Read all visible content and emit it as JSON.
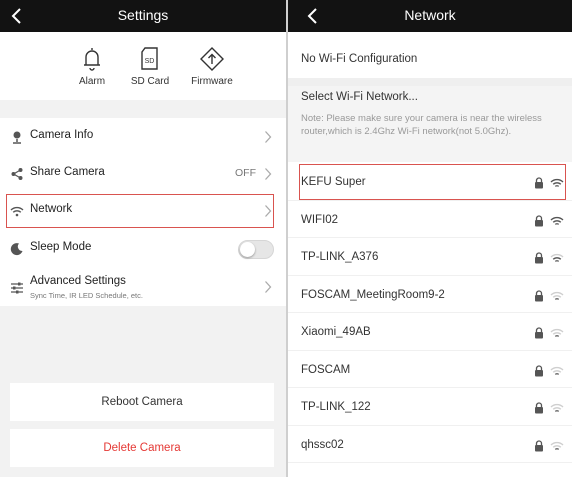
{
  "settings": {
    "title": "Settings",
    "quick": {
      "alarm": "Alarm",
      "sd_card": "SD Card",
      "firmware": "Firmware",
      "sd_glyph_text": "SD"
    },
    "rows": {
      "camera_info": "Camera Info",
      "share_camera": "Share Camera",
      "share_camera_value": "OFF",
      "network": "Network",
      "sleep_mode": "Sleep Mode",
      "sleep_mode_on": false,
      "advanced": "Advanced Settings",
      "advanced_sub": "Sync Time, IR LED Schedule, etc."
    },
    "reboot": "Reboot Camera",
    "delete": "Delete Camera"
  },
  "network": {
    "title": "Network",
    "no_wifi": "No Wi-Fi Configuration",
    "select_heading": "Select Wi-Fi Network...",
    "note": "Note: Please make sure your camera is near the wireless router,which is 2.4Ghz Wi-Fi network(not 5.0Ghz).",
    "networks": [
      {
        "name": "KEFU Super",
        "secured": true,
        "signal": "strong",
        "highlighted": true
      },
      {
        "name": "WIFI02",
        "secured": true,
        "signal": "strong"
      },
      {
        "name": "TP-LINK_A376",
        "secured": true,
        "signal": "medium"
      },
      {
        "name": "FOSCAM_MeetingRoom9-2",
        "secured": true,
        "signal": "weak"
      },
      {
        "name": "Xiaomi_49AB",
        "secured": true,
        "signal": "weak"
      },
      {
        "name": "FOSCAM",
        "secured": true,
        "signal": "weak"
      },
      {
        "name": "TP-LINK_122",
        "secured": true,
        "signal": "weak"
      },
      {
        "name": "qhssc02",
        "secured": true,
        "signal": "weak"
      }
    ]
  },
  "colors": {
    "header": "#121212",
    "highlight": "#d9534f",
    "danger": "#e53935",
    "background": "#f2f2f2"
  }
}
